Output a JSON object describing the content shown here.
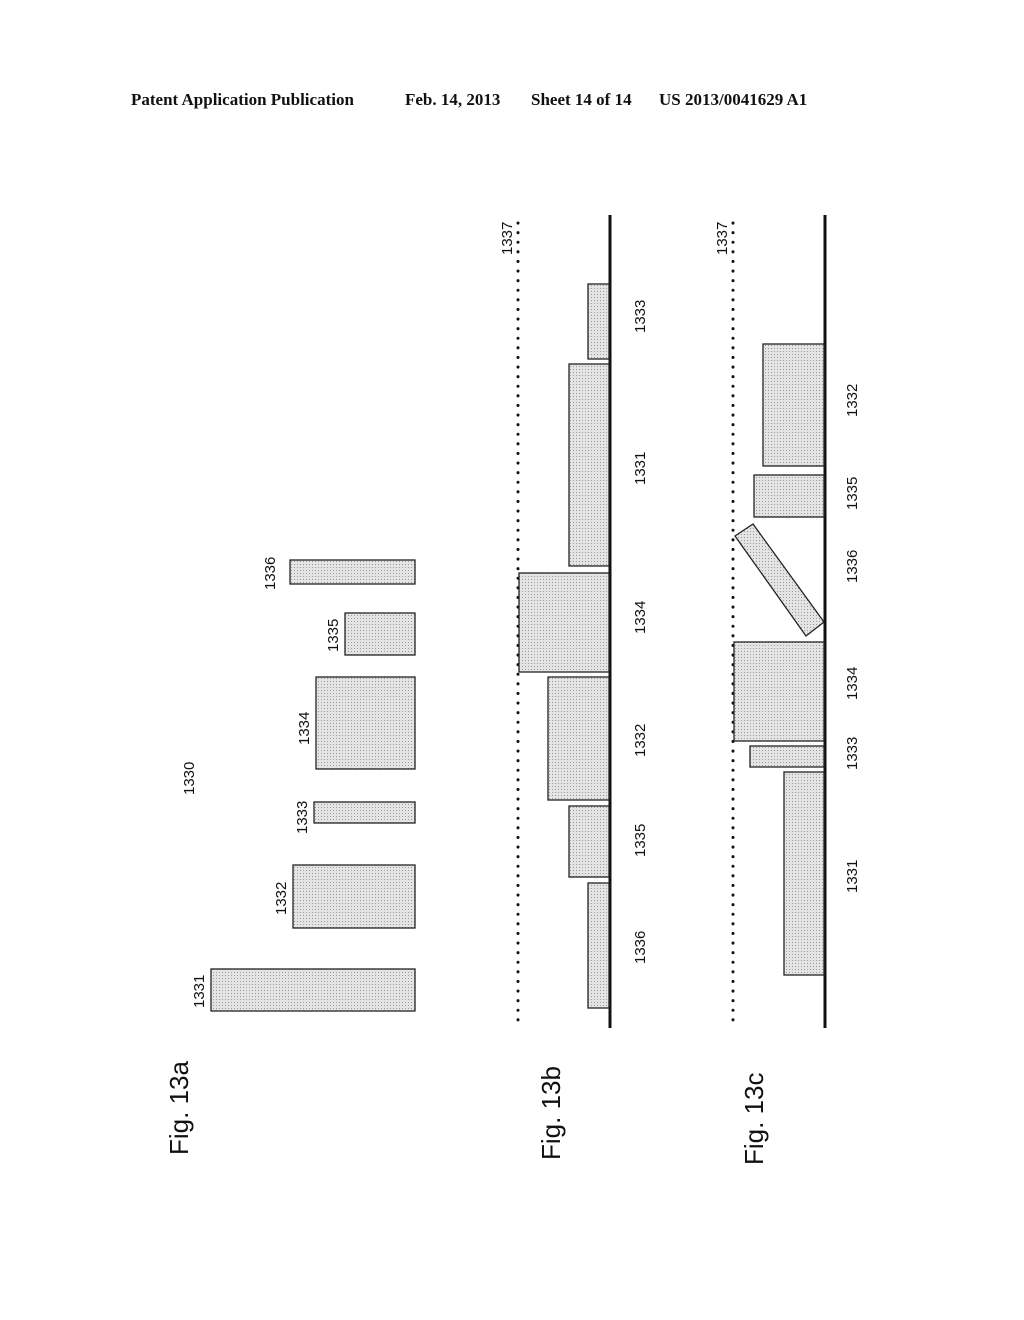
{
  "header": {
    "publication": "Patent Application Publication",
    "date": "Feb. 14, 2013",
    "sheet": "Sheet 14 of 14",
    "number": "US 2013/0041629 A1"
  },
  "figures": [
    {
      "label": "Fig. 13a",
      "group_ref": "1330",
      "blocks": [
        {
          "ref": "1331"
        },
        {
          "ref": "1332"
        },
        {
          "ref": "1333"
        },
        {
          "ref": "1334"
        },
        {
          "ref": "1335"
        },
        {
          "ref": "1336"
        }
      ]
    },
    {
      "label": "Fig. 13b",
      "threshold_ref": "1337",
      "block_order": [
        "1336",
        "1335",
        "1332",
        "1334",
        "1331",
        "1333"
      ]
    },
    {
      "label": "Fig. 13c",
      "threshold_ref": "1337",
      "block_order": [
        "1331",
        "1333",
        "1334",
        "1336",
        "1335",
        "1332"
      ]
    }
  ],
  "colors": {
    "block_fill": "#d8d8d8",
    "outline": "#222222"
  }
}
